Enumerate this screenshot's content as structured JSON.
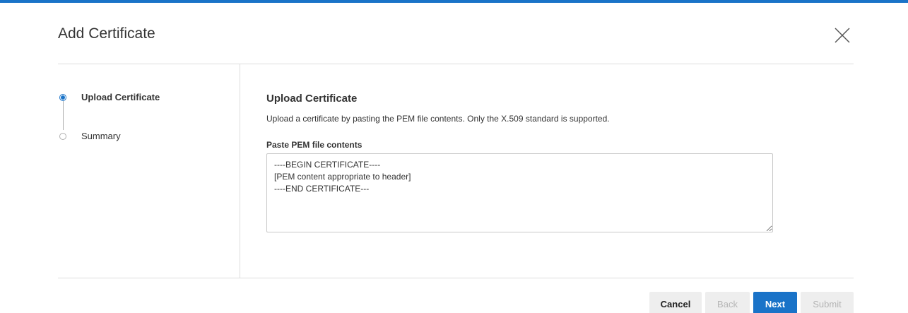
{
  "dialog": {
    "title": "Add Certificate",
    "close_icon": "close-icon"
  },
  "wizard": {
    "steps": [
      {
        "label": "Upload Certificate",
        "active": true
      },
      {
        "label": "Summary",
        "active": false
      }
    ]
  },
  "content": {
    "title": "Upload Certificate",
    "description": "Upload a certificate by pasting the PEM file contents. Only the X.509 standard is supported.",
    "pem_field": {
      "label": "Paste PEM file contents",
      "value": "----BEGIN CERTIFICATE----\n[PEM content appropriate to header]\n----END CERTIFICATE---"
    }
  },
  "footer": {
    "cancel_label": "Cancel",
    "back_label": "Back",
    "next_label": "Next",
    "submit_label": "Submit"
  },
  "colors": {
    "accent": "#1a73c8",
    "divider": "#dddddd",
    "disabled_text": "#b5b5b5",
    "button_bg": "#eeeeee"
  }
}
